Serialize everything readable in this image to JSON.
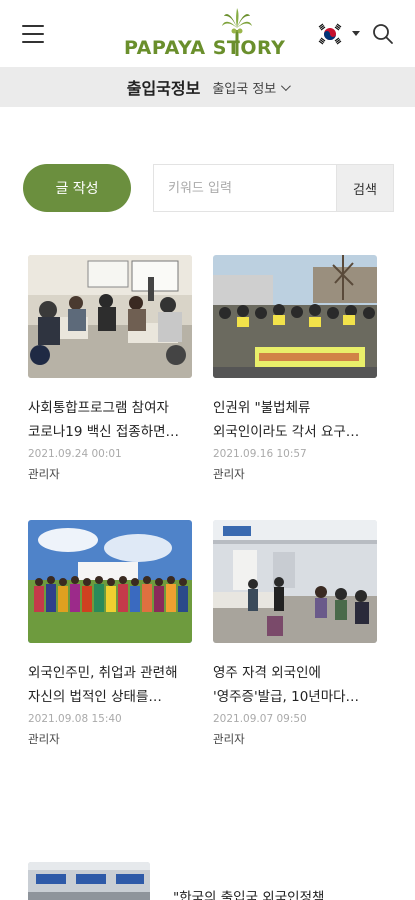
{
  "header": {
    "logo_text": "PAPAYA STORY",
    "language_flag": "korean-flag",
    "menu_icon": "hamburger-icon",
    "search_icon": "search-icon"
  },
  "category": {
    "title": "출입국정보",
    "selected": "출입국 정보"
  },
  "actions": {
    "write_label": "글 작성",
    "search_placeholder": "키워드 입력",
    "search_button": "검색"
  },
  "posts": [
    {
      "title_line1": "사회통합프로그램 참여자",
      "title_line2": "코로나19 백신 접종하면…",
      "date": "2021.09.24 00:01",
      "author": "관리자"
    },
    {
      "title_line1": "인권위 \"불법체류",
      "title_line2": "외국인이라도 각서 요구…",
      "date": "2021.09.16 10:57",
      "author": "관리자"
    },
    {
      "title_line1": "외국인주민, 취업과 관련해",
      "title_line2": "자신의 법적인 상태를…",
      "date": "2021.09.08 15:40",
      "author": "관리자"
    },
    {
      "title_line1": "영주 자격 외국인에",
      "title_line2": "'영주증'발급, 10년마다…",
      "date": "2021.09.07 09:50",
      "author": "관리자"
    }
  ],
  "list_items": [
    {
      "title": "\"한국의 출입국 외국인정책…"
    }
  ],
  "colors": {
    "brand_green": "#6b8f3e",
    "logo_green": "#6a8f2c",
    "category_bar": "#ebebeb"
  }
}
